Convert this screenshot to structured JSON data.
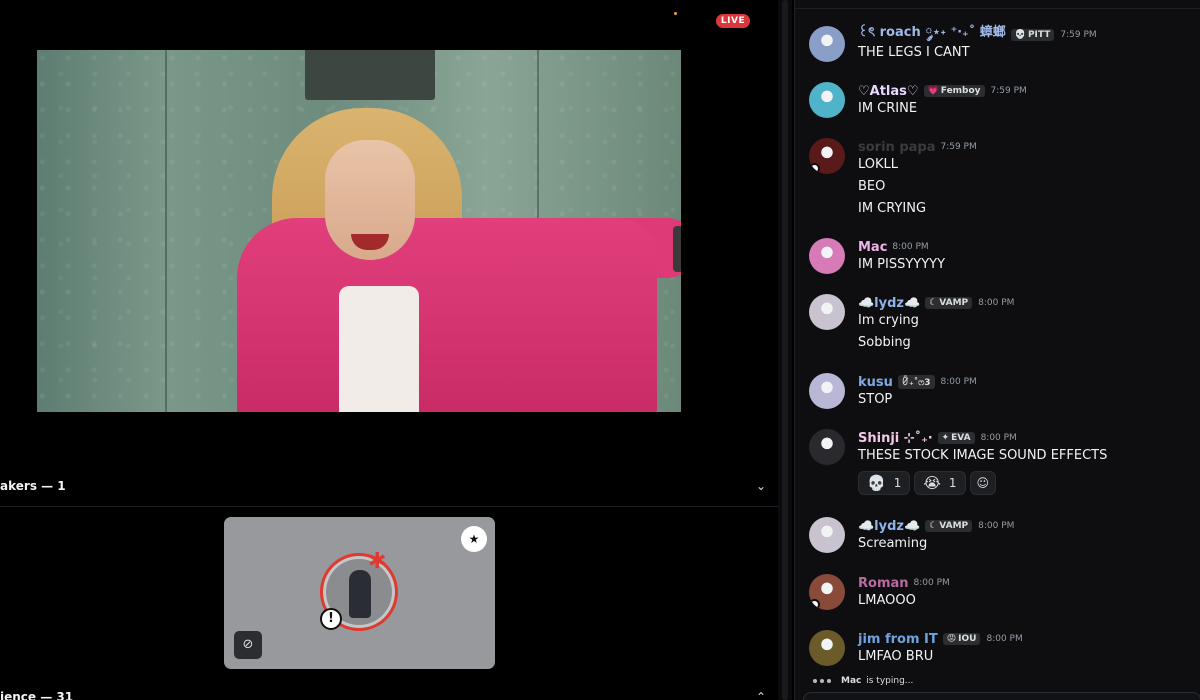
{
  "stage": {
    "live_badge": "LIVE",
    "speakers_label": "akers — 1",
    "audience_label": "ience — 31"
  },
  "chat": {
    "messages": [
      {
        "name": "꒰ৎ roach ༘⋆˖ ⁺‧₊˚ 蟑螂",
        "name_color": "#9fb8e6",
        "tag": "PITT",
        "tag_icon": "skull-icon",
        "time": "7:59 PM",
        "lines": [
          "THE LEGS I CANT"
        ],
        "avatar_color": "#8a9ec7"
      },
      {
        "name": "♡Atlas♡",
        "name_color": "#e8d7ff",
        "tag": "Femboy",
        "tag_icon": "heart-icon",
        "time": "7:59 PM",
        "lines": [
          "IM CRINE"
        ],
        "avatar_color": "#4fb3c9"
      },
      {
        "name": "sorin papa",
        "name_color": "#3a3a3f",
        "tag": "",
        "tag_icon": "",
        "time": "7:59 PM",
        "lines": [
          "LOKLL",
          "BEO",
          "IM CRYING"
        ],
        "avatar_color": "#5a1a1a"
      },
      {
        "name": "Mac",
        "name_color": "#f0b3e6",
        "tag": "",
        "tag_icon": "",
        "time": "8:00 PM",
        "lines": [
          "IM PISSYYYYY"
        ],
        "avatar_color": "#d77ab8"
      },
      {
        "name": "☁️lydz☁️",
        "name_color": "#8fb3e8",
        "tag": "VAMP",
        "tag_icon": "crescent-icon",
        "time": "8:00 PM",
        "lines": [
          "Im crying",
          "Sobbing"
        ],
        "avatar_color": "#c9c2cf"
      },
      {
        "name": "kusu",
        "name_color": "#7fa8e0",
        "tag": "ꀛ₊˚ෆ3",
        "tag_icon": "",
        "time": "8:00 PM",
        "lines": [
          "STOP"
        ],
        "avatar_color": "#b8b8d6"
      },
      {
        "name": "Shinji ⊹˚₊‧",
        "name_color": "#f2c9e8",
        "tag": "EVA",
        "tag_icon": "sparkle-icon",
        "time": "8:00 PM",
        "lines": [
          "THESE STOCK IMAGE SOUND EFFECTS"
        ],
        "avatar_color": "#2a2a2e"
      },
      {
        "name": "☁️lydz☁️",
        "name_color": "#8fb3e8",
        "tag": "VAMP",
        "tag_icon": "crescent-icon",
        "time": "8:00 PM",
        "lines": [
          "Screaming"
        ],
        "avatar_color": "#c9c2cf"
      },
      {
        "name": "Roman",
        "name_color": "#b86b9e",
        "tag": "",
        "tag_icon": "",
        "time": "8:00 PM",
        "lines": [
          "LMAOOO"
        ],
        "avatar_color": "#8a4a3a"
      },
      {
        "name": "jim from IT",
        "name_color": "#6fa3e0",
        "tag": "IOU",
        "tag_icon": "angry-icon",
        "time": "8:00 PM",
        "lines": [
          "LMFAO BRU"
        ],
        "avatar_color": "#6b5a2a"
      }
    ],
    "reactions": [
      {
        "emoji": "💀",
        "count": "1"
      },
      {
        "emoji": "😭",
        "count": "1"
      }
    ],
    "typing_user": "Mac",
    "typing_suffix": "is typing..."
  },
  "colors": {
    "live": "#da373c",
    "background": "#000000",
    "chat_bg": "#0e0e11"
  }
}
